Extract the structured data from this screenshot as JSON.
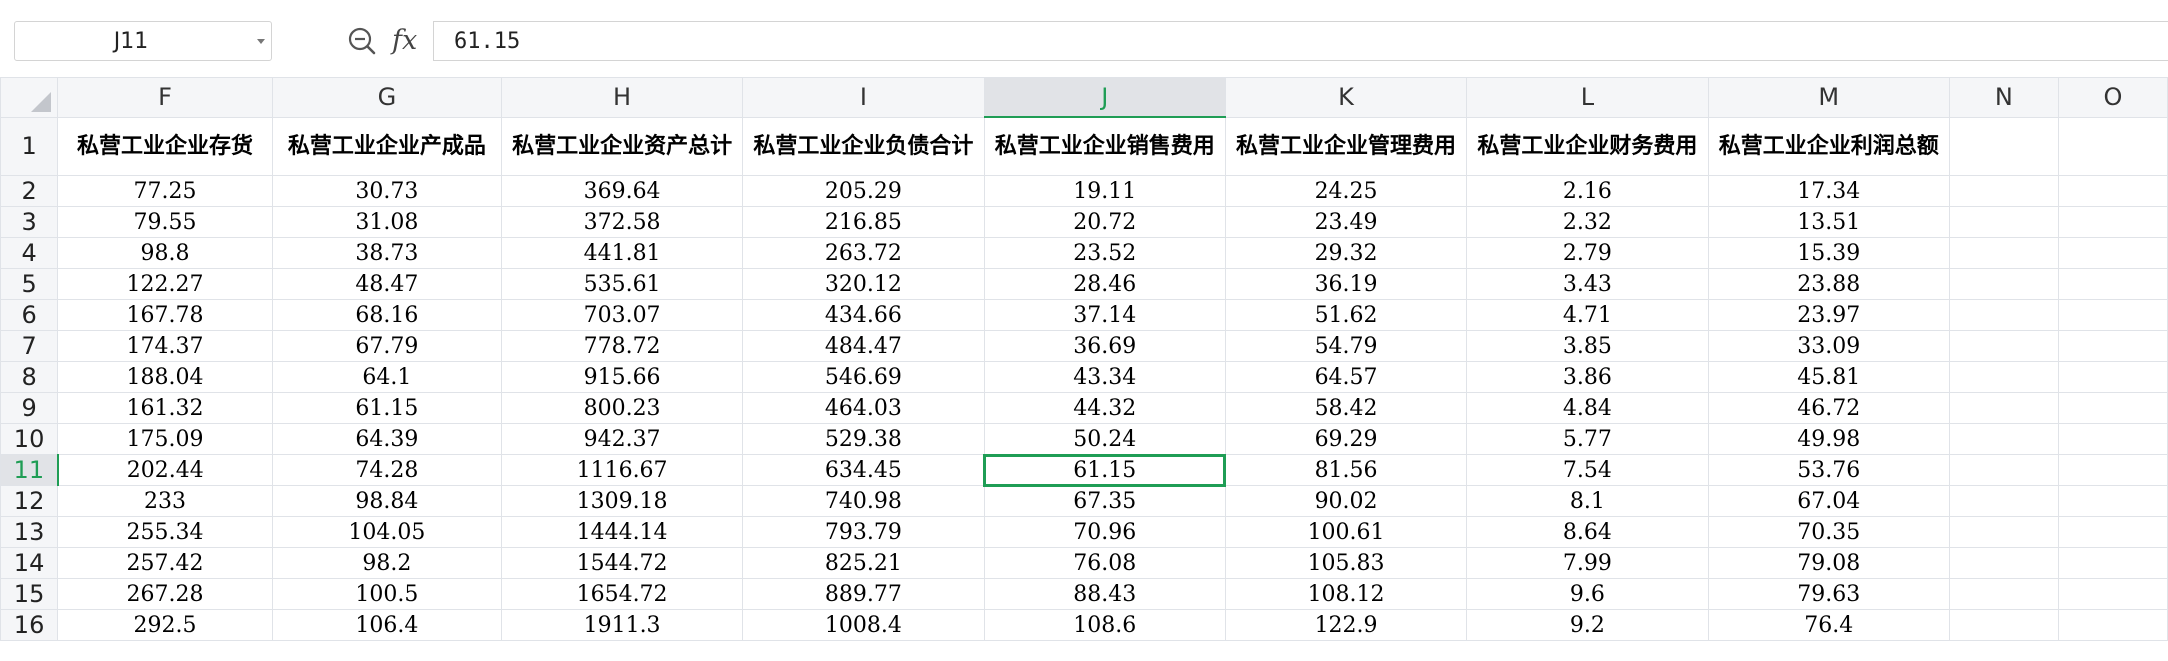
{
  "name_box": {
    "value": "J11"
  },
  "formula_bar": {
    "fx_label": "fx",
    "value": "61.15",
    "zoom_icon": "zoom-formula-icon"
  },
  "selection": {
    "column": "J",
    "row": "11"
  },
  "colors": {
    "accent": "#1f9d55",
    "header_bg": "#f5f6f8",
    "gridline": "#e0e3e8"
  },
  "columns": [
    "F",
    "G",
    "H",
    "I",
    "J",
    "K",
    "L",
    "M",
    "N",
    "O"
  ],
  "rows": [
    "1",
    "2",
    "3",
    "4",
    "5",
    "6",
    "7",
    "8",
    "9",
    "10",
    "11",
    "12",
    "13",
    "14",
    "15",
    "16"
  ],
  "headers": [
    "私营工业企业存货",
    "私营工业企业产成品",
    "私营工业企业资产总计",
    "私营工业企业负债合计",
    "私营工业企业销售费用",
    "私营工业企业管理费用",
    "私营工业企业财务费用",
    "私营工业企业利润总额"
  ],
  "data": [
    [
      "77.25",
      "30.73",
      "369.64",
      "205.29",
      "19.11",
      "24.25",
      "2.16",
      "17.34"
    ],
    [
      "79.55",
      "31.08",
      "372.58",
      "216.85",
      "20.72",
      "23.49",
      "2.32",
      "13.51"
    ],
    [
      "98.8",
      "38.73",
      "441.81",
      "263.72",
      "23.52",
      "29.32",
      "2.79",
      "15.39"
    ],
    [
      "122.27",
      "48.47",
      "535.61",
      "320.12",
      "28.46",
      "36.19",
      "3.43",
      "23.88"
    ],
    [
      "167.78",
      "68.16",
      "703.07",
      "434.66",
      "37.14",
      "51.62",
      "4.71",
      "23.97"
    ],
    [
      "174.37",
      "67.79",
      "778.72",
      "484.47",
      "36.69",
      "54.79",
      "3.85",
      "33.09"
    ],
    [
      "188.04",
      "64.1",
      "915.66",
      "546.69",
      "43.34",
      "64.57",
      "3.86",
      "45.81"
    ],
    [
      "161.32",
      "61.15",
      "800.23",
      "464.03",
      "44.32",
      "58.42",
      "4.84",
      "46.72"
    ],
    [
      "175.09",
      "64.39",
      "942.37",
      "529.38",
      "50.24",
      "69.29",
      "5.77",
      "49.98"
    ],
    [
      "202.44",
      "74.28",
      "1116.67",
      "634.45",
      "61.15",
      "81.56",
      "7.54",
      "53.76"
    ],
    [
      "233",
      "98.84",
      "1309.18",
      "740.98",
      "67.35",
      "90.02",
      "8.1",
      "67.04"
    ],
    [
      "255.34",
      "104.05",
      "1444.14",
      "793.79",
      "70.96",
      "100.61",
      "8.64",
      "70.35"
    ],
    [
      "257.42",
      "98.2",
      "1544.72",
      "825.21",
      "76.08",
      "105.83",
      "7.99",
      "79.08"
    ],
    [
      "267.28",
      "100.5",
      "1654.72",
      "889.77",
      "88.43",
      "108.12",
      "9.6",
      "79.63"
    ],
    [
      "292.5",
      "106.4",
      "1911.3",
      "1008.4",
      "108.6",
      "122.9",
      "9.2",
      "76.4"
    ]
  ]
}
